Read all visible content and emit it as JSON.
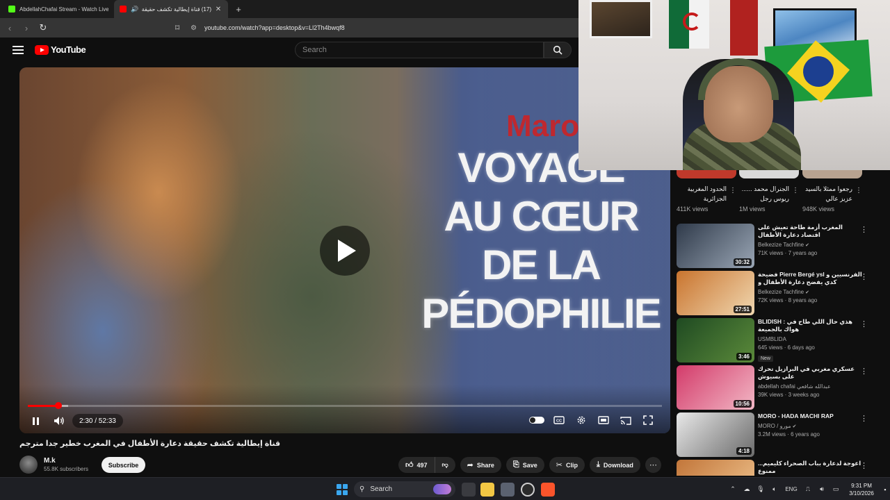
{
  "browser": {
    "tabs": [
      {
        "title": "AbdellahChafai Stream - Watch Live :",
        "active": false
      },
      {
        "title": "(17) قناة إيطالية تكشف حقيقة",
        "active": true
      }
    ],
    "url": "youtube.com/watch?app=desktop&v=Ll2Th4bwqf8"
  },
  "youtube": {
    "logo_text": "YouTube",
    "search_placeholder": "Search"
  },
  "player": {
    "overlay_red": "Maro",
    "overlay_title_lines": [
      "VOYAGE",
      "AU CŒUR",
      "DE LA",
      "PÉDOPHILIE"
    ],
    "time_current": "2:30",
    "time_total": "52:33",
    "time_display": "2:30 / 52:33",
    "progress_fraction": 0.048,
    "buffered_fraction": 0.064
  },
  "video": {
    "title": "قناة إيطالية تكشف حقيقة دعارة الأطفال في المغرب خطير جدا مترجم",
    "channel_name": "M.k",
    "subscribers": "55.8K subscribers",
    "subscribe_label": "Subscribe",
    "likes": "497",
    "share_label": "Share",
    "save_label": "Save",
    "clip_label": "Clip",
    "download_label": "Download"
  },
  "sidebar": {
    "shorts": [
      {
        "title": "رجعوا ممثلا بالسيد عزيز عالي",
        "views": "948K views",
        "color": "#b8a390"
      },
      {
        "title": "الجنرال محمد ...... ريوس رجل",
        "views": "1M views",
        "color": "#d9d9d9"
      },
      {
        "title": "الحدود المغربية الجزائرية",
        "views": "411K views",
        "color": "#c0392b"
      }
    ],
    "videos": [
      {
        "title": "المغرب أزمة طاحة تعيش على اقتصاد دعارة الأطفال",
        "channel": "Belkezize Tachfine",
        "meta": "71K views · 7 years ago",
        "duration": "30:32",
        "verified": true,
        "badge": "",
        "thumb": [
          "#2f3a4a",
          "#9aa6b5"
        ]
      },
      {
        "title": "فضيحة Pierre Bergé  ysl الفرنسيين و كدي يفضح دعارة الأطفال و البيدوفيليا في",
        "channel": "Belkezize Tachfine",
        "meta": "72K views · 8 years ago",
        "duration": "27:51",
        "verified": true,
        "badge": "",
        "thumb": [
          "#c9742e",
          "#f0d7b0"
        ]
      },
      {
        "title": "BLIDISH : هذي حال اللي طاح في هواك بالجميعة",
        "channel": "USMBLIDA",
        "meta": "645 views · 6 days ago",
        "duration": "3:46",
        "verified": false,
        "badge": "New",
        "thumb": [
          "#1f4a22",
          "#5b8a3a"
        ]
      },
      {
        "title": "عسكري مغربي في البرازيل تحرك على بسيوش",
        "channel": "abdellah chafai عبدالله شافعي",
        "meta": "39K views · 3 weeks ago",
        "duration": "10:56",
        "verified": false,
        "badge": "",
        "thumb": [
          "#d33b6a",
          "#f2b7c5"
        ]
      },
      {
        "title": "MORO - HADA MACHI RAP",
        "channel": "MORO / مورو",
        "meta": "3.2M views · 6 years ago",
        "duration": "4:18",
        "verified": true,
        "badge": "",
        "thumb": [
          "#e8e8e8",
          "#6b6b6b"
        ]
      },
      {
        "title": "اعوجة لدعارة بباب الصحراء كليميم... ممنوع",
        "channel": "",
        "meta": "",
        "duration": "",
        "verified": false,
        "badge": "",
        "thumb": [
          "#c2763a",
          "#f0c590"
        ]
      }
    ]
  },
  "taskbar": {
    "search_label": "Search",
    "language": "ENG",
    "time": "9:31 PM",
    "date": "3/10/2026"
  }
}
